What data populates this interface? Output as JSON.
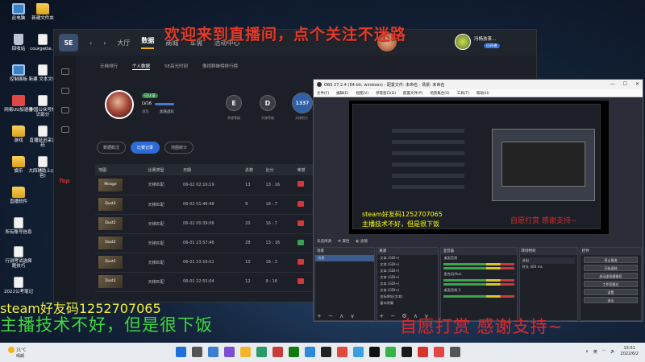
{
  "overlays": {
    "title": "欢迎来到直播间，点个关注不迷路",
    "steam": "steam好友码1252707065",
    "quote": "主播技术不好，但是很下饭",
    "donate": "自愿打赏 感谢支持~"
  },
  "desktop": {
    "icons": [
      {
        "label": "此电脑",
        "type": "pc"
      },
      {
        "label": "新建文件夹",
        "type": "folder"
      },
      {
        "label": "回收站",
        "type": "bin"
      },
      {
        "label": "courgette...",
        "type": "doc"
      },
      {
        "label": "控制面板",
        "type": "pc"
      },
      {
        "label": "新建 文本文档",
        "type": "doc"
      },
      {
        "label": "网易UU加速器",
        "type": "app"
      },
      {
        "label": "中国公众号知识部分",
        "type": "doc"
      },
      {
        "label": "游戏",
        "type": "folder"
      },
      {
        "label": "直播延迟采证码",
        "type": "doc"
      },
      {
        "label": "娱乐",
        "type": "folder"
      },
      {
        "label": "大四辅助上(内容)",
        "type": "doc"
      },
      {
        "label": "直播软件",
        "type": "folder"
      },
      {
        "label": "所有账号信息",
        "type": "doc"
      },
      {
        "label": "百度网盘",
        "type": "app"
      },
      {
        "label": "行测考试选择题技巧",
        "type": "doc"
      },
      {
        "label": "2022公考笔记",
        "type": "doc"
      }
    ]
  },
  "app5e": {
    "logo": "5E",
    "nav": [
      "大厅",
      "数据",
      "商城",
      "军需",
      "活动中心"
    ],
    "active_nav": "数据",
    "subtabs": [
      "天梯排行",
      "个人数据",
      "5E高光时刻",
      "傲视群雄榜排行榜"
    ],
    "active_subtab": "个人数据",
    "player": {
      "level": "LV16",
      "tag": "已认证",
      "team_label": "战队",
      "team": "加速战队"
    },
    "ranks": [
      {
        "badge": "E",
        "label": "常规等级"
      },
      {
        "badge": "D",
        "label": "天梯等级"
      },
      {
        "badge": "1337",
        "label": "天梯积分"
      }
    ],
    "filter_tabs": [
      "数据概况",
      "比赛记录",
      "地图统计"
    ],
    "active_filter": "比赛记录",
    "table": {
      "headers": [
        "地图",
        "比赛类型",
        "日期",
        "杀数",
        "比分",
        "荣誉"
      ],
      "rows": [
        {
          "map": "Mirage",
          "type": "天梯匹配",
          "date": "06-02 02:16:19",
          "kills": "13",
          "score": "13 : 16",
          "result": "lose"
        },
        {
          "map": "Dust2",
          "type": "天梯匹配",
          "date": "06-02 01:46:48",
          "kills": "9",
          "score": "16 : 7",
          "result": "lose"
        },
        {
          "map": "Dust2",
          "type": "天梯匹配",
          "date": "06-02 00:39:06",
          "kills": "20",
          "score": "16 : 7",
          "result": "lose"
        },
        {
          "map": "Dust2",
          "type": "天梯匹配",
          "date": "06-01 23:57:46",
          "kills": "28",
          "score": "13 : 16",
          "result": "win"
        },
        {
          "map": "Dust2",
          "type": "天梯匹配",
          "date": "06-01 23:16:01",
          "kills": "10",
          "score": "16 : 3",
          "result": "lose"
        },
        {
          "map": "Dust2",
          "type": "天梯匹配",
          "date": "06-01 22:55:04",
          "kills": "12",
          "score": "9 : 16",
          "result": "lose"
        }
      ]
    },
    "user_name": "冯杨孩茶...",
    "vip": "已开通"
  },
  "obs": {
    "title": "OBS 27.2.4 (64-bit, windows) - 配置文件: 未命名 - 场景: 未命名",
    "menu": [
      "文件(F)",
      "编辑(E)",
      "视图(V)",
      "停靠窗口(D)",
      "配置文件(P)",
      "场景集合(S)",
      "工具(T)",
      "帮助(H)"
    ],
    "preview_text1": "steam好友码1252707065",
    "preview_text2": "主播技术不好，但是很下饭",
    "preview_red": "自愿打赏 感谢支持~",
    "mute_label": "未选择源",
    "props_label": "属性",
    "filter_label": "滤镜",
    "docks": {
      "scenes": {
        "title": "场景",
        "items": [
          "场景"
        ]
      },
      "sources": {
        "title": "来源",
        "items": [
          "文本 (GDI+)",
          "文本 (GDI+)",
          "文本 (GDI+)",
          "文本 (GDI+)",
          "文本 (GDI+)",
          "文本 (GDI+)",
          "金标地址(文本)",
          "窗口采集"
        ]
      },
      "mixer": {
        "title": "混音器",
        "items": [
          "桌面音频",
          "麦克风/Aux",
          "桌面音频 2"
        ]
      },
      "transitions": {
        "title": "转场特效",
        "type": "淡出",
        "duration_label": "时长",
        "duration": "300 ms"
      },
      "controls": {
        "title": "控件",
        "buttons": [
          "停止推流",
          "开始录制",
          "启动虚拟摄像机",
          "工作室模式",
          "设置",
          "退出"
        ]
      }
    }
  },
  "taskbar": {
    "temp": "31°C",
    "weather": "晴朗",
    "lang": "英",
    "time": "15:51",
    "date": "2022/6/2"
  },
  "colors": {
    "accent_blue": "#2e6bd6",
    "overlay_red": "#e23a2a",
    "overlay_yellow": "#f4f234",
    "overlay_green": "#3fd83f"
  }
}
